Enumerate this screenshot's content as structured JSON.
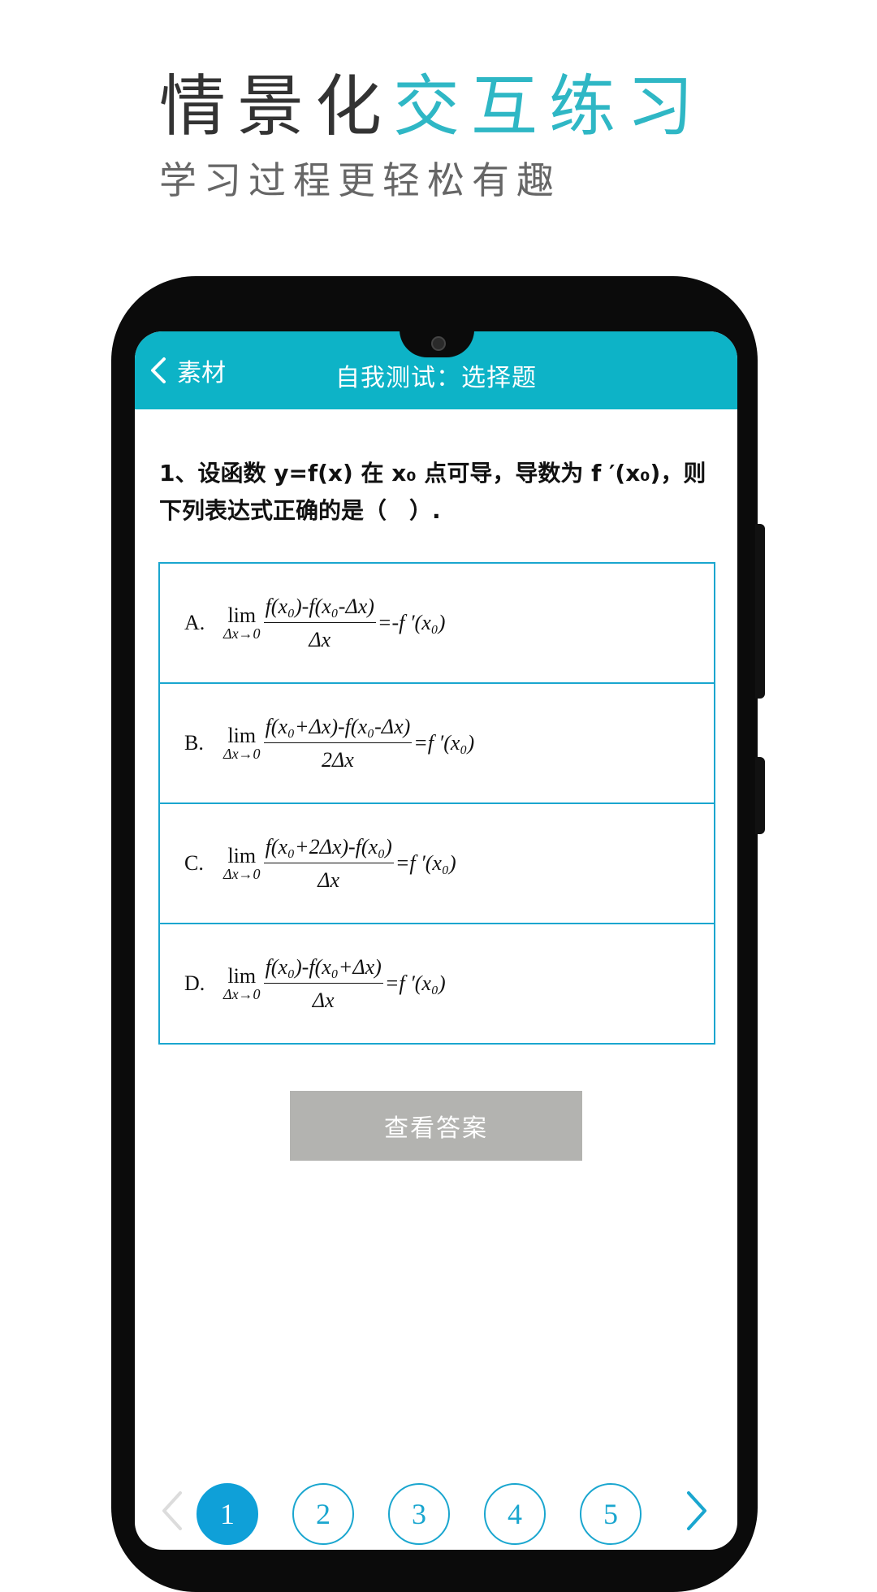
{
  "headline": {
    "part1": "情景化",
    "part2": "交互练习"
  },
  "subheadline": "学习过程更轻松有趣",
  "navbar": {
    "back_label": "素材",
    "title": "自我测试：选择题"
  },
  "question": {
    "line1": "1、设函数 y=f(x) 在 x₀ 点可导，导数为 f ′(x₀)，则",
    "line2": "下列表达式正确的是（　）."
  },
  "options": [
    {
      "letter": "A.",
      "lim_top": "lim",
      "lim_bottom": "Δx→0",
      "numerator": "f(x₀)-f(x₀-Δx)",
      "denominator": "Δx",
      "rhs": "=-f ′(x₀)"
    },
    {
      "letter": "B.",
      "lim_top": "lim",
      "lim_bottom": "Δx→0",
      "numerator": "f(x₀+Δx)-f(x₀-Δx)",
      "denominator": "2Δx",
      "rhs": "=f ′(x₀)"
    },
    {
      "letter": "C.",
      "lim_top": "lim",
      "lim_bottom": "Δx→0",
      "numerator": "f(x₀+2Δx)-f(x₀)",
      "denominator": "Δx",
      "rhs": "=f ′(x₀)"
    },
    {
      "letter": "D.",
      "lim_top": "lim",
      "lim_bottom": "Δx→0",
      "numerator": "f(x₀)-f(x₀+Δx)",
      "denominator": "Δx",
      "rhs": "=f ′(x₀)"
    }
  ],
  "answer_button": "查看答案",
  "pager": {
    "pages": [
      "1",
      "2",
      "3",
      "4",
      "5"
    ],
    "active_page": "1",
    "prev_icon": "chevron-left-icon",
    "next_icon": "chevron-right-icon"
  },
  "colors": {
    "accent": "#2fb7c5",
    "navbar": "#0db3c7",
    "border": "#1aa6cf",
    "active_page": "#0fa0d8",
    "button_gray": "#b3b3b0"
  }
}
